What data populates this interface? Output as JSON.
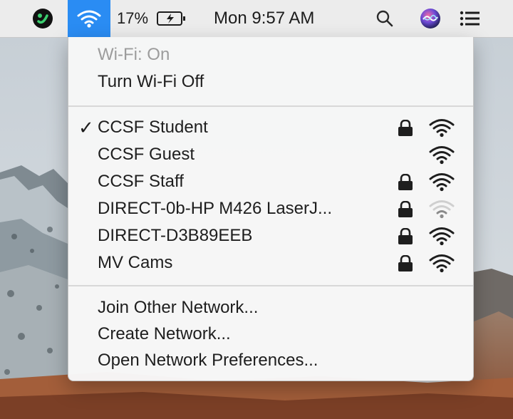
{
  "menubar": {
    "battery_percent": "17%",
    "clock": "Mon 9:57 AM",
    "icons": [
      "app-status-icon",
      "wifi-icon",
      "battery-charging-icon",
      "spotlight-search-icon",
      "siri-icon",
      "notification-center-icon"
    ]
  },
  "wifi_menu": {
    "status": "Wi-Fi: On",
    "toggle_label": "Turn Wi-Fi Off",
    "networks": [
      {
        "name": "CCSF Student",
        "selected": true,
        "locked": true,
        "signal": "strong"
      },
      {
        "name": "CCSF Guest",
        "selected": false,
        "locked": false,
        "signal": "strong"
      },
      {
        "name": "CCSF Staff",
        "selected": false,
        "locked": true,
        "signal": "strong"
      },
      {
        "name": "DIRECT-0b-HP M426 LaserJ...",
        "selected": false,
        "locked": true,
        "signal": "weak"
      },
      {
        "name": "DIRECT-D3B89EEB",
        "selected": false,
        "locked": true,
        "signal": "strong"
      },
      {
        "name": "MV Cams",
        "selected": false,
        "locked": true,
        "signal": "strong"
      }
    ],
    "check_mark": "✓",
    "actions": [
      "Join Other Network...",
      "Create Network...",
      "Open Network Preferences..."
    ]
  },
  "colors": {
    "menubar_bg": "#ececec",
    "wifi_highlight": "#2a8cf3",
    "menu_bg": "#f6f6f6",
    "disabled_text": "#9c9c9c"
  }
}
